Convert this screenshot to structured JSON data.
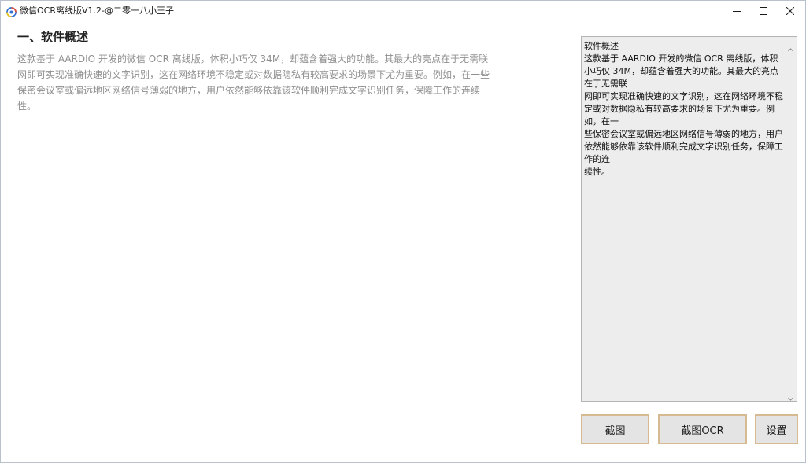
{
  "window": {
    "title": "微信OCR离线版V1.2-@二零一八小王子",
    "icon": "app-logo-icon",
    "controls": {
      "minimize_icon": "minimize-icon",
      "maximize_icon": "maximize-icon",
      "close_icon": "close-icon"
    }
  },
  "content": {
    "heading": "一、软件概述",
    "body": "这款基于 AARDIO 开发的微信 OCR 离线版，体积小巧仅 34M，却蕴含着强大的功能。其最大的亮点在于无需联网即可实现准确快速的文字识别，这在网络环境不稳定或对数据隐私有较高要求的场景下尤为重要。例如，在一些保密会议室或偏远地区网络信号薄弱的地方，用户依然能够依靠该软件顺利完成文字识别任务，保障工作的连续性。"
  },
  "ocr_output": {
    "text": "软件概述\n这款基于 AARDIO 开发的微信 OCR 离线版，体积小巧仅 34M，却蕴含着强大的功能。其最大的亮点在于无需联\n网即可实现准确快速的文字识别，这在网络环境不稳定或对数据隐私有较高要求的场景下尤为重要。例如，在一\n些保密会议室或偏远地区网络信号薄弱的地方，用户依然能够依靠该软件顺利完成文字识别任务，保障工作的连\n续性。",
    "scroll_up_icon": "scroll-up-arrow-icon",
    "scroll_down_icon": "scroll-down-arrow-icon"
  },
  "actions": {
    "screenshot_label": "截图",
    "screenshot_ocr_label": "截图OCR",
    "settings_label": "设置"
  },
  "colors": {
    "button_border": "#d7ba92",
    "button_bg": "#e4e4e4",
    "output_bg": "#ededed",
    "body_text": "#8f8f8f"
  }
}
